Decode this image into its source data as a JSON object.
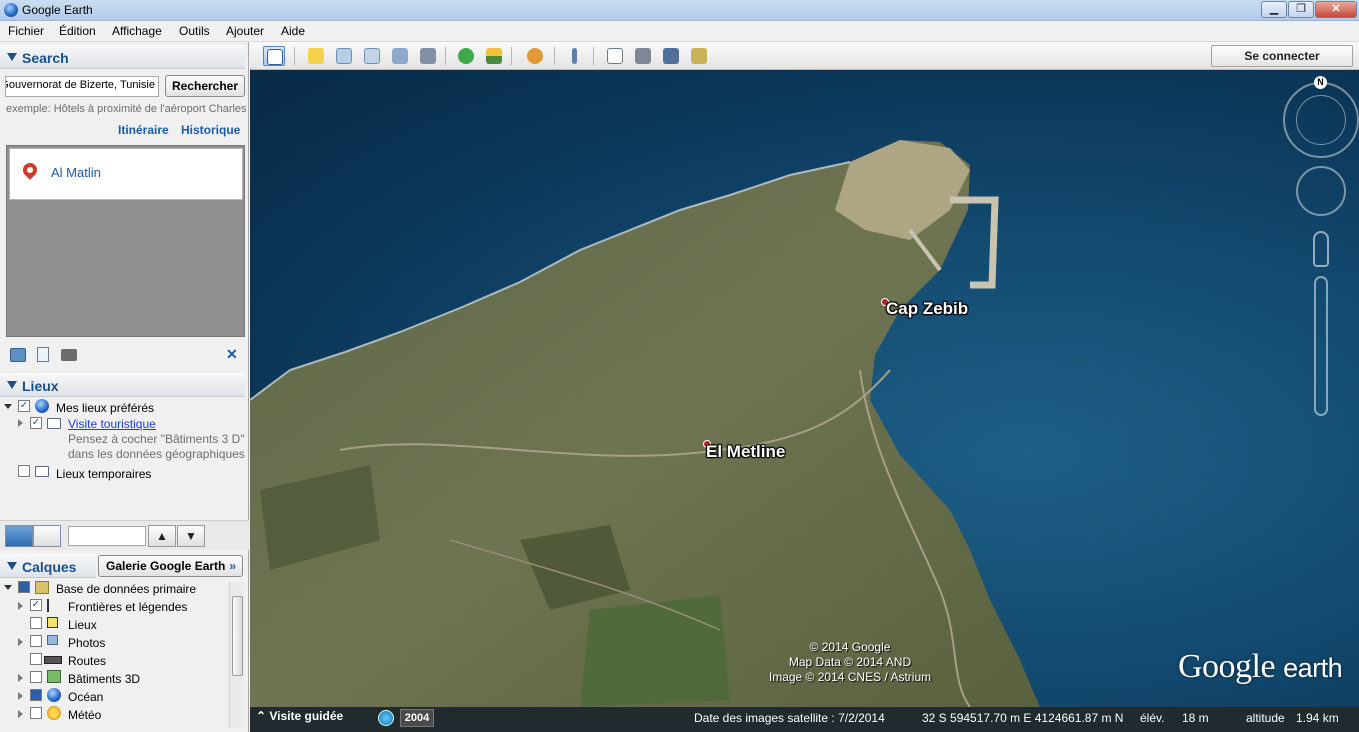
{
  "window": {
    "title": "Google Earth",
    "min_label": "▁",
    "max_label": "❐",
    "close_label": "✕"
  },
  "menu": [
    "Fichier",
    "Édition",
    "Affichage",
    "Outils",
    "Ajouter",
    "Aide"
  ],
  "search": {
    "heading": "Search",
    "query_value": "Gouvernorat de Bizerte, Tunisie",
    "button_label": "Rechercher",
    "example": "exemple: Hôtels à proximité de l'aéroport Charles",
    "itinerary_link": "Itinéraire",
    "history_link": "Historique",
    "result": "Al Matlin"
  },
  "places": {
    "heading": "Lieux",
    "items": [
      {
        "label": "Mes lieux préférés",
        "checked": true
      },
      {
        "label": "Visite touristique",
        "checked": true
      },
      {
        "label": "Lieux temporaires",
        "checked": false
      }
    ],
    "hint_line1": "Pensez à cocher \"Bâtiments 3 D\"",
    "hint_line2": "dans les données géographiques"
  },
  "layers": {
    "heading": "Calques",
    "gallery_button": "Galerie Google Earth",
    "gallery_chevron": "»",
    "items": [
      {
        "label": "Base de données primaire",
        "checked": true
      },
      {
        "label": "Frontières et légendes",
        "checked": true
      },
      {
        "label": "Lieux",
        "checked": false
      },
      {
        "label": "Photos",
        "checked": false
      },
      {
        "label": "Routes",
        "checked": false
      },
      {
        "label": "Bâtiments 3D",
        "checked": false
      },
      {
        "label": "Océan",
        "checked": false
      },
      {
        "label": "Météo",
        "checked": false
      }
    ]
  },
  "toolbar": {
    "signin_label": "Se connecter",
    "icons": [
      "sidebar-toggle-icon",
      "placemark-icon",
      "polygon-icon",
      "path-icon",
      "image-overlay-icon",
      "record-tour-icon",
      "historical-imagery-icon",
      "sunlight-icon",
      "planets-icon",
      "ruler-icon",
      "email-icon",
      "print-icon",
      "save-image-icon",
      "view-in-maps-icon"
    ]
  },
  "map": {
    "placemarks": [
      {
        "label": "Cap Zebib"
      },
      {
        "label": "El Metline"
      }
    ],
    "attribution_line1": "© 2014 Google",
    "attribution_line2": "Map Data © 2014 AND",
    "attribution_line3": "Image © 2014 CNES / Astrium",
    "logo_word1": "Google",
    "logo_word2": "earth",
    "north_label": "N"
  },
  "status": {
    "tour_label": "Visite guidée",
    "year": "2004",
    "imagery_date": "Date des images satellite : 7/2/2014",
    "coords": "32 S 594517.70 m E 4124661.87 m N",
    "elev_label": "élév.",
    "elev_value": "18 m",
    "alt_label": "altitude",
    "alt_value": "1.94 km"
  },
  "colors": {
    "accent_blue": "#1b4f8a",
    "link_blue": "#1d5aa8",
    "placemark_red": "#b8232b",
    "sea": "#134a70"
  }
}
